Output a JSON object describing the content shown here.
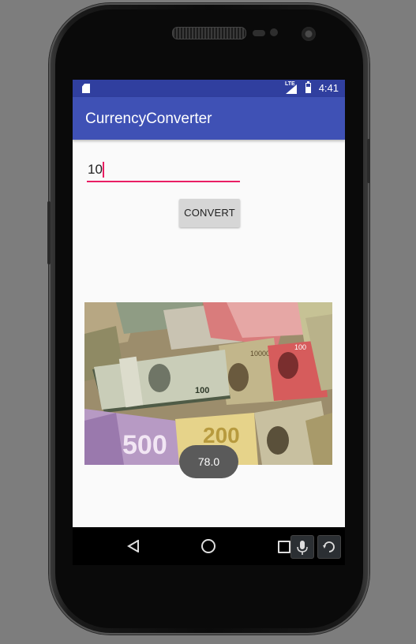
{
  "status_bar": {
    "time": "4:41",
    "network_label": "LTE",
    "icons": [
      "sd-card-icon",
      "signal-icon",
      "battery-icon"
    ]
  },
  "app_bar": {
    "title": "CurrencyConverter",
    "color": "#3f51b5"
  },
  "amount_input": {
    "value": "10",
    "underline_color": "#e91e63"
  },
  "convert_button": {
    "label": "CONVERT"
  },
  "currency_image": {
    "banknote_labels": [
      "500",
      "200",
      "100",
      "10000"
    ]
  },
  "toast": {
    "text": "78.0"
  },
  "nav_bar": {
    "icons": [
      "back-icon",
      "home-icon",
      "recents-icon",
      "mic-icon",
      "rotate-icon"
    ]
  }
}
